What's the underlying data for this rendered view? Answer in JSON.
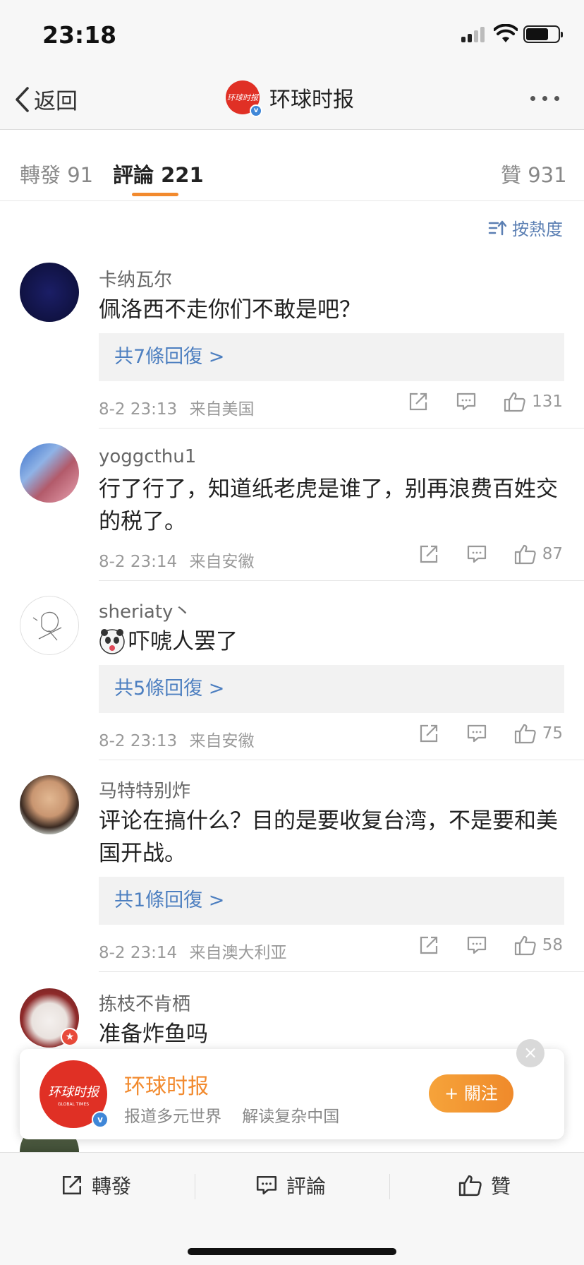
{
  "status_bar": {
    "time": "23:18"
  },
  "header": {
    "back_label": "返回",
    "account_name": "环球时报",
    "avatar_logo_text": "环球时报"
  },
  "tabs": [
    {
      "label": "轉發 91"
    },
    {
      "label": "評論 221"
    },
    {
      "label": "贊 931"
    }
  ],
  "sort_label": "按熱度",
  "comments": [
    {
      "user": "卡纳瓦尔",
      "text": "佩洛西不走你们不敢是吧？",
      "replies": "共7條回復 >",
      "time": "8-2 23:13",
      "location": "来自美国",
      "likes": "131"
    },
    {
      "user": "yoggcthu1",
      "text": "行了行了，知道纸老虎是谁了，别再浪费百姓交的税了。",
      "time": "8-2 23:14",
      "location": "来自安徽",
      "likes": "87"
    },
    {
      "user": "sheriaty丶",
      "text": "吓唬人罢了",
      "replies": "共5條回復 >",
      "time": "8-2 23:13",
      "location": "来自安徽",
      "likes": "75"
    },
    {
      "user": "马特特别炸",
      "text": "评论在搞什么？目的是要收复台湾，不是要和美国开战。",
      "replies": "共1條回復 >",
      "time": "8-2 23:14",
      "location": "来自澳大利亚",
      "likes": "58"
    },
    {
      "user": "拣枝不肯栖",
      "text": "准备炸鱼吗"
    }
  ],
  "follow_card": {
    "name": "环球时报",
    "description": "报道多元世界    解读复杂中国",
    "follow_label": "+ 關注",
    "logo_text": "环球时报",
    "logo_subtext": "GLOBAL TIMES"
  },
  "bottom_bar": {
    "repost": "轉發",
    "comment": "評論",
    "like": "贊"
  },
  "colors": {
    "accent": "#f28a2e",
    "link": "#4d7fc0",
    "brand_red": "#e03025"
  }
}
